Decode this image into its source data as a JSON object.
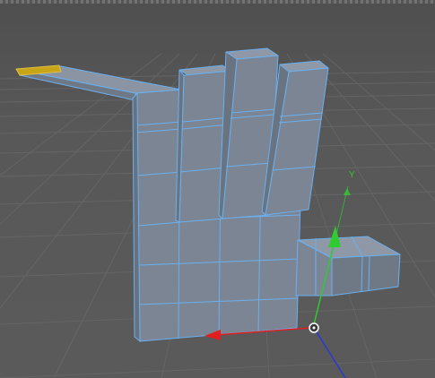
{
  "viewport": {
    "background_color": "#575757",
    "grid_color": "#6a6a6a",
    "mesh_fill_color": "#7d8794",
    "mesh_edge_color": "#6ab0f0",
    "selected_face_color": "#c8a418"
  },
  "gizmo": {
    "y_axis_label": "Y",
    "y_axis_color": "#2ecc2e",
    "x_axis_color": "#e02020",
    "z_axis_color": "#2a3ad0",
    "pivot_icon": "pivot-handle-icon"
  }
}
